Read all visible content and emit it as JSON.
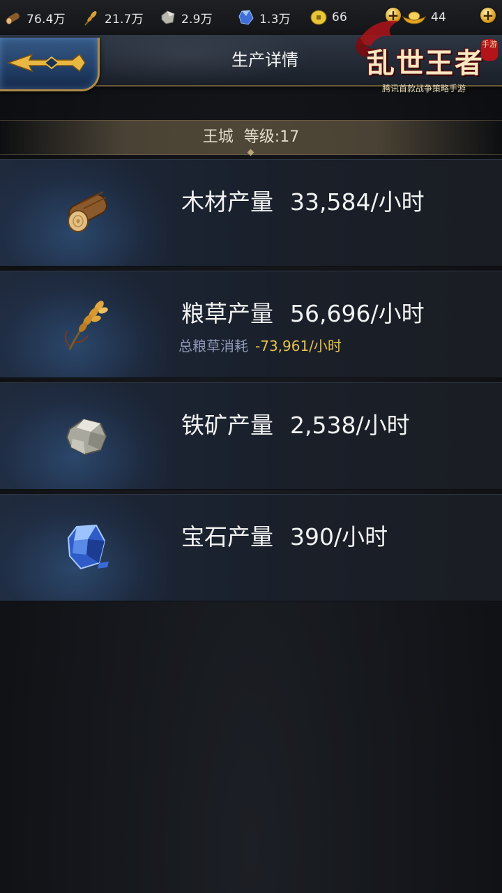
{
  "resources": [
    {
      "name": "wood",
      "icon": "wood-log-icon",
      "value": "76.4万"
    },
    {
      "name": "grain",
      "icon": "wheat-icon",
      "value": "21.7万"
    },
    {
      "name": "iron",
      "icon": "iron-ore-icon",
      "value": "2.9万"
    },
    {
      "name": "gem",
      "icon": "gem-icon",
      "value": "1.3万"
    },
    {
      "name": "copper",
      "icon": "coin-icon",
      "value": "66"
    },
    {
      "name": "ingot",
      "icon": "gold-ingot-icon",
      "value": "44"
    }
  ],
  "header": {
    "title": "生产详情",
    "logo_text": "乱世王者",
    "logo_badge": "手游",
    "logo_subtitle": "腾讯首款战争策略手游"
  },
  "city": {
    "name": "王城",
    "level_label": "等级:17"
  },
  "production": [
    {
      "label": "木材产量",
      "rate": "33,584/小时",
      "icon": "wood-log-icon"
    },
    {
      "label": "粮草产量",
      "rate": "56,696/小时",
      "icon": "wheat-icon",
      "consumption_label": "总粮草消耗",
      "consumption_value": "-73,961/小时"
    },
    {
      "label": "铁矿产量",
      "rate": "2,538/小时",
      "icon": "iron-ore-icon"
    },
    {
      "label": "宝石产量",
      "rate": "390/小时",
      "icon": "gem-icon"
    }
  ],
  "colors": {
    "accent_gold": "#b08a45",
    "consumption": "#e8c24a",
    "back_button": "#23416a"
  }
}
